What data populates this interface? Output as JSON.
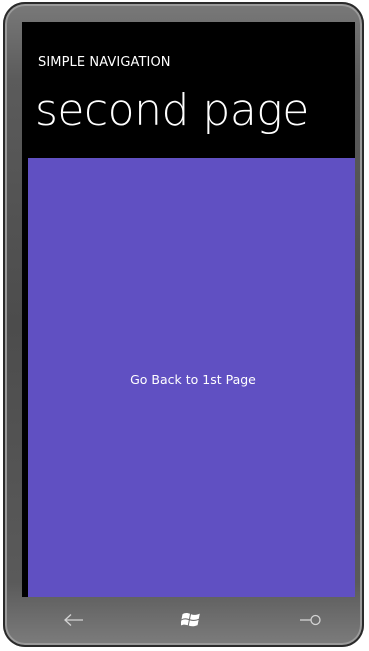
{
  "app": {
    "title": "SIMPLE NAVIGATION",
    "page_title": "second page"
  },
  "content": {
    "button_label": "Go Back to 1st Page",
    "background_color": "#6050c2"
  },
  "hardware_buttons": [
    {
      "name": "back",
      "icon": "back-arrow-icon"
    },
    {
      "name": "start",
      "icon": "windows-logo-icon"
    },
    {
      "name": "search",
      "icon": "search-icon"
    }
  ]
}
